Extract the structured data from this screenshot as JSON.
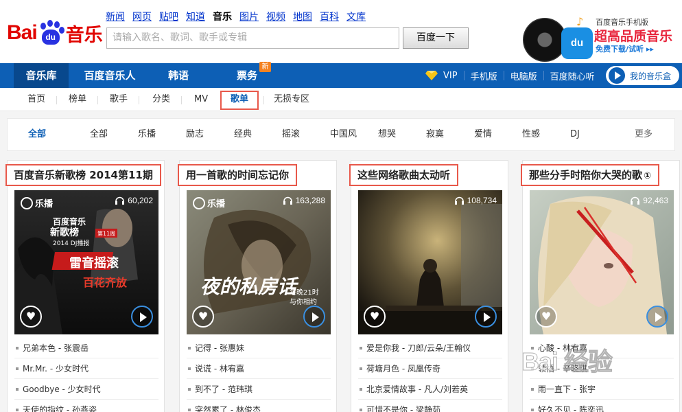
{
  "logo": {
    "text_bai": "Bai",
    "text_du": "du",
    "text_music": "音乐"
  },
  "topnav": [
    "新闻",
    "网页",
    "贴吧",
    "知道",
    "音乐",
    "图片",
    "视频",
    "地图",
    "百科",
    "文库"
  ],
  "search": {
    "placeholder": "请输入歌名、歌词、歌手或专辑",
    "button": "百度一下"
  },
  "promo": {
    "line1": "百度音乐手机版",
    "line2": "超高品质音乐",
    "line3": "免费下载/试听 ▸▸",
    "icon_text": "du"
  },
  "mainnav": {
    "tabs": [
      "音乐库",
      "百度音乐人",
      "韩语",
      "票务"
    ],
    "new_badge": "新",
    "vip": "VIP",
    "links": [
      "手机版",
      "电脑版",
      "百度随心听"
    ],
    "mybox": "我的音乐盒"
  },
  "subnav": [
    "首页",
    "榜单",
    "歌手",
    "分类",
    "MV",
    "歌单",
    "无损专区"
  ],
  "categories": [
    "全部",
    "全部",
    "乐播",
    "励志",
    "经典",
    "摇滚",
    "中国风",
    "想哭",
    "寂寞",
    "爱情",
    "性感",
    "DJ",
    "更多"
  ],
  "cards": [
    {
      "title": "百度音乐新歌榜 2014第11期",
      "listens": "60,202",
      "cover_brand": "乐播",
      "cover_lines": [
        "百度音乐",
        "新歌榜",
        "2014 DJ播报",
        "第11周",
        "雷音摇滚",
        "百花齐放"
      ],
      "tracks": [
        "兄弟本色 - 张震岳",
        "Mr.Mr. - 少女时代",
        "Goodbye - 少女时代",
        "天使的指纹 - 孙燕姿"
      ]
    },
    {
      "title": "用一首歌的时间忘记你",
      "listens": "163,288",
      "cover_brand": "乐播",
      "cover_lines": [
        "夜的私房话",
        "每晚21时",
        "与你相约"
      ],
      "tracks": [
        "记得 - 张惠妹",
        "说谎 - 林宥嘉",
        "到不了 - 范玮琪",
        "突然累了 - 林俊杰"
      ]
    },
    {
      "title": "这些网络歌曲太动听",
      "listens": "108,734",
      "tracks": [
        "爱是你我 - 刀郎/云朵/王翰仪",
        "荷塘月色 - 凤凰传奇",
        "北京爱情故事 - 凡人/刘若英",
        "可惜不是你 - 梁静茹"
      ]
    },
    {
      "title": "那些分手时陪你大哭的歌",
      "title_icon": "①",
      "listens": "92,463",
      "tracks": [
        "心酸 - 林宥嘉",
        "领悟 - 辛晓琪",
        "雨一直下 - 张宇",
        "好久不见 - 陈奕迅"
      ]
    }
  ],
  "watermark": "Bai 经验",
  "colors": {
    "brand_red": "#e10602",
    "nav_blue": "#0d5fb5",
    "highlight_red": "#e8584a",
    "link_blue": "#0033cc"
  }
}
